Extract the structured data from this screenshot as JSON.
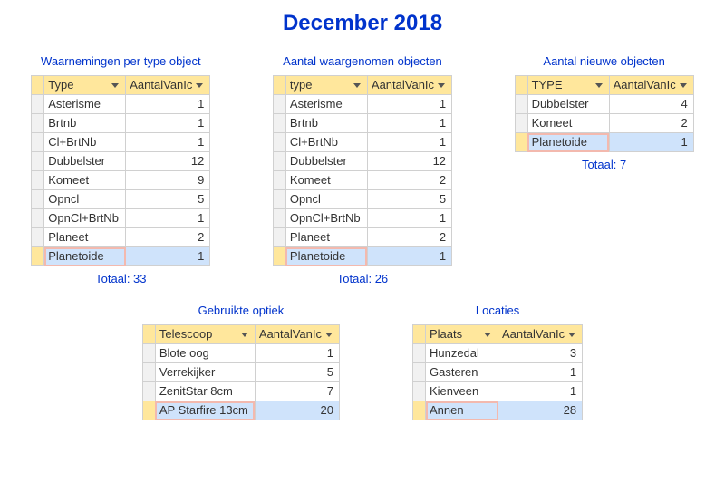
{
  "title": "December 2018",
  "labels": {
    "total_prefix": "Totaal: "
  },
  "panels": {
    "perType": {
      "heading": "Waarnemingen per type object",
      "col1": "Type",
      "col2": "AantalVanIc",
      "total": 33,
      "rows": [
        {
          "name": "Asterisme",
          "count": 1
        },
        {
          "name": "Brtnb",
          "count": 1
        },
        {
          "name": "Cl+BrtNb",
          "count": 1
        },
        {
          "name": "Dubbelster",
          "count": 12
        },
        {
          "name": "Komeet",
          "count": 9
        },
        {
          "name": "Opncl",
          "count": 5
        },
        {
          "name": "OpnCl+BrtNb",
          "count": 1
        },
        {
          "name": "Planeet",
          "count": 2
        },
        {
          "name": "Planetoide",
          "count": 1
        }
      ]
    },
    "objects": {
      "heading": "Aantal waargenomen objecten",
      "col1": "type",
      "col2": "AantalVanIc",
      "total": 26,
      "rows": [
        {
          "name": "Asterisme",
          "count": 1
        },
        {
          "name": "Brtnb",
          "count": 1
        },
        {
          "name": "Cl+BrtNb",
          "count": 1
        },
        {
          "name": "Dubbelster",
          "count": 12
        },
        {
          "name": "Komeet",
          "count": 2
        },
        {
          "name": "Opncl",
          "count": 5
        },
        {
          "name": "OpnCl+BrtNb",
          "count": 1
        },
        {
          "name": "Planeet",
          "count": 2
        },
        {
          "name": "Planetoide",
          "count": 1
        }
      ]
    },
    "newObj": {
      "heading": "Aantal nieuwe objecten",
      "col1": "TYPE",
      "col2": "AantalVanIc",
      "total": 7,
      "rows": [
        {
          "name": "Dubbelster",
          "count": 4
        },
        {
          "name": "Komeet",
          "count": 2
        },
        {
          "name": "Planetoide",
          "count": 1
        }
      ]
    },
    "optics": {
      "heading": "Gebruikte optiek",
      "col1": "Telescoop",
      "col2": "AantalVanIc",
      "rows": [
        {
          "name": "Blote oog",
          "count": 1
        },
        {
          "name": "Verrekijker",
          "count": 5
        },
        {
          "name": "ZenitStar 8cm",
          "count": 7
        },
        {
          "name": "AP Starfire 13cm",
          "count": 20
        }
      ]
    },
    "loc": {
      "heading": "Locaties",
      "col1": "Plaats",
      "col2": "AantalVanIc",
      "rows": [
        {
          "name": "Hunzedal",
          "count": 3
        },
        {
          "name": "Gasteren",
          "count": 1
        },
        {
          "name": "Kienveen",
          "count": 1
        },
        {
          "name": "Annen",
          "count": 28
        }
      ]
    }
  }
}
